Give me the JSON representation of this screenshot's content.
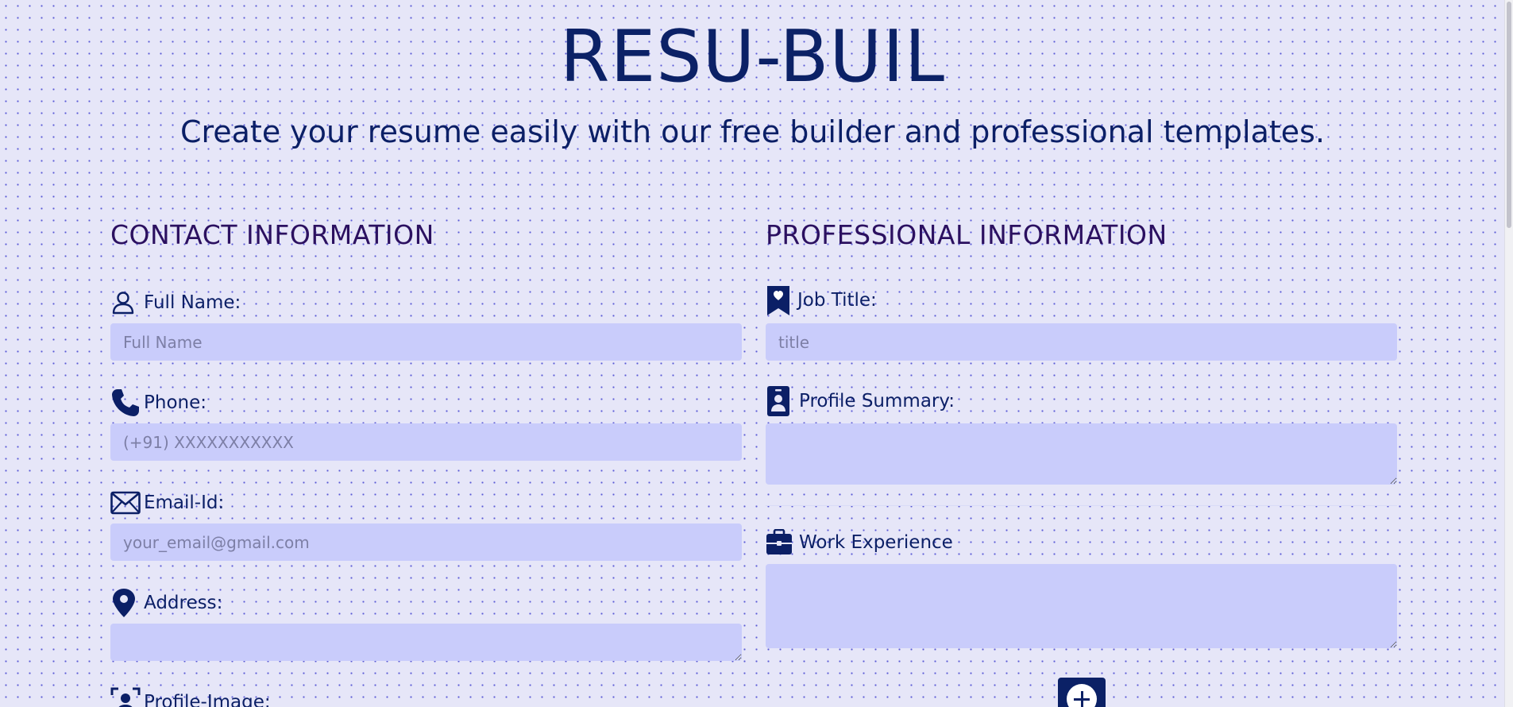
{
  "app": {
    "title": "RESU-BUIL",
    "tagline": "Create your resume easily with our free builder and professional templates."
  },
  "contact": {
    "heading": "CONTACT INFORMATION",
    "full_name": {
      "label": "Full Name:",
      "placeholder": "Full Name",
      "icon": "user-icon"
    },
    "phone": {
      "label": "Phone:",
      "placeholder": "(+91) XXXXXXXXXXX",
      "icon": "phone-icon"
    },
    "email": {
      "label": "Email-Id:",
      "placeholder": "your_email@gmail.com",
      "icon": "envelope-icon"
    },
    "address": {
      "label": "Address:",
      "placeholder": "",
      "icon": "map-pin-icon"
    },
    "profile_image": {
      "label": "Profile-Image:",
      "icon": "profile-image-icon"
    }
  },
  "professional": {
    "heading": "PROFESSIONAL INFORMATION",
    "job_title": {
      "label": "Job Title:",
      "placeholder": "title",
      "icon": "bookmark-heart-icon"
    },
    "profile_summary": {
      "label": "Profile Summary:",
      "placeholder": "",
      "icon": "id-badge-icon"
    },
    "work_experience": {
      "label": "Work Experience",
      "placeholder": "",
      "icon": "briefcase-icon"
    },
    "add_button_icon": "plus-circle-icon"
  },
  "colors": {
    "background": "#e6e6f8",
    "dots": "#5a5ad6",
    "title": "#0b2166",
    "heading": "#2b1060",
    "input_bg": "#c9ccfb",
    "accent": "#0b2166"
  }
}
